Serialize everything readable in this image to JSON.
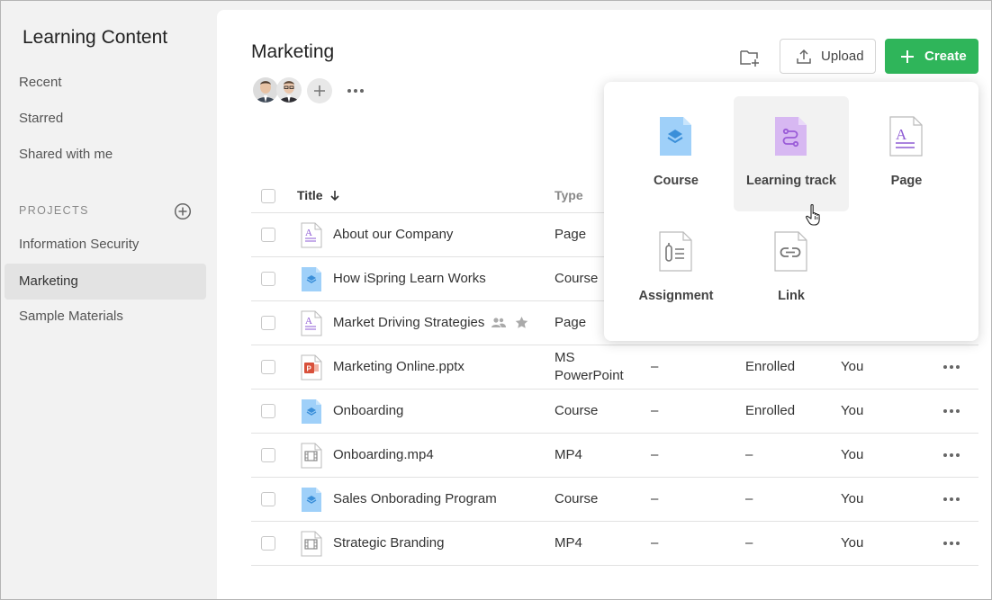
{
  "sidebar": {
    "title": "Learning Content",
    "nav": [
      {
        "label": "Recent"
      },
      {
        "label": "Starred"
      },
      {
        "label": "Shared with me"
      }
    ],
    "projects_label": "PROJECTS",
    "projects": [
      {
        "label": "Information Security"
      },
      {
        "label": "Marketing",
        "active": true
      },
      {
        "label": "Sample Materials"
      }
    ]
  },
  "header": {
    "title": "Marketing",
    "upload_label": "Upload",
    "create_label": "Create"
  },
  "table": {
    "columns": {
      "title": "Title",
      "type": "Type"
    },
    "rows": [
      {
        "title": "About our Company",
        "type": "Page",
        "c3": "",
        "c4": "",
        "c5": "",
        "icon": "page"
      },
      {
        "title": "How iSpring Learn Works",
        "type": "Course",
        "c3": "",
        "c4": "",
        "c5": "",
        "icon": "course"
      },
      {
        "title": "Market Driving Strategies",
        "type": "Page",
        "c3": "",
        "c4": "",
        "c5": "",
        "icon": "page",
        "shared": true,
        "starred": true
      },
      {
        "title": "Marketing Online.pptx",
        "type": "MS PowerPoint",
        "type_line1": "MS",
        "type_line2": "PowerPoint",
        "c3": "–",
        "c4": "Enrolled",
        "c5": "You",
        "icon": "ppt"
      },
      {
        "title": "Onboarding",
        "type": "Course",
        "c3": "–",
        "c4": "Enrolled",
        "c5": "You",
        "icon": "course"
      },
      {
        "title": "Onboarding.mp4",
        "type": "MP4",
        "c3": "–",
        "c4": "–",
        "c5": "You",
        "icon": "video"
      },
      {
        "title": "Sales Onborading Program",
        "type": "Course",
        "c3": "–",
        "c4": "–",
        "c5": "You",
        "icon": "course"
      },
      {
        "title": "Strategic Branding",
        "type": "MP4",
        "c3": "–",
        "c4": "–",
        "c5": "You",
        "icon": "video"
      }
    ]
  },
  "create_menu": {
    "items": [
      {
        "label": "Course",
        "icon": "course-icon"
      },
      {
        "label": "Learning track",
        "icon": "learning-track-icon",
        "hovered": true
      },
      {
        "label": "Page",
        "icon": "page-icon"
      },
      {
        "label": "Assignment",
        "icon": "assignment-icon"
      },
      {
        "label": "Link",
        "icon": "link-icon"
      }
    ]
  },
  "colors": {
    "accent_green": "#2fb55a",
    "course_blue": "#9fd0f9",
    "track_purple": "#d7b8f2",
    "page_purple": "#8e5bd4",
    "ppt_red": "#d8503a"
  }
}
